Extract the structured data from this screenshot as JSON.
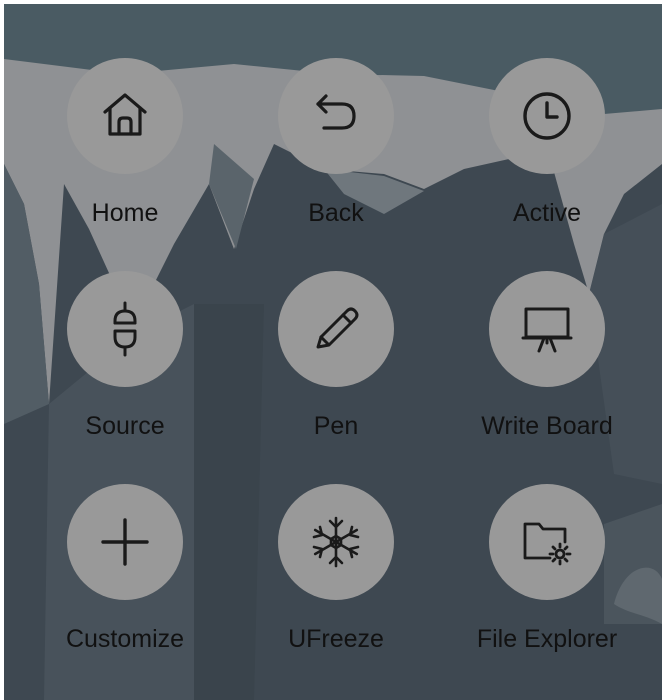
{
  "theme": {
    "accent_circle": "#999999",
    "label_color": "#111111",
    "backdrop_top": "#4a5a62",
    "backdrop_bottom": "#3c4650"
  },
  "menu": {
    "items": [
      {
        "label": "Home",
        "icon": "home-icon"
      },
      {
        "label": "Back",
        "icon": "back-arrow-icon"
      },
      {
        "label": "Active",
        "icon": "clock-icon"
      },
      {
        "label": "Source",
        "icon": "plug-icon"
      },
      {
        "label": "Pen",
        "icon": "pencil-icon"
      },
      {
        "label": "Write Board",
        "icon": "whiteboard-icon"
      },
      {
        "label": "Customize",
        "icon": "plus-icon"
      },
      {
        "label": "UFreeze",
        "icon": "snowflake-icon"
      },
      {
        "label": "File Explorer",
        "icon": "folder-gear-icon"
      }
    ]
  }
}
